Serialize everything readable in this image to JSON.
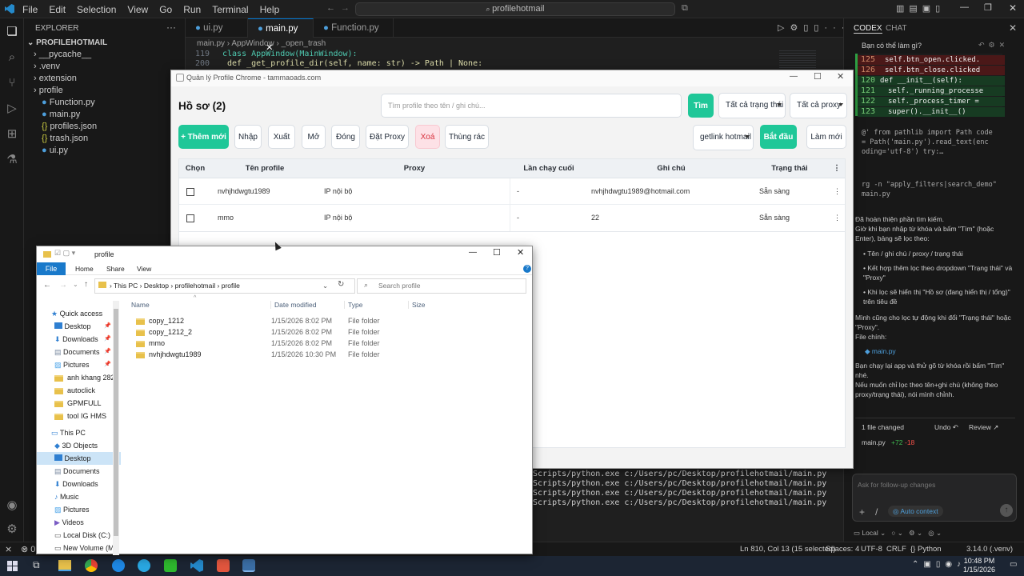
{
  "vscode": {
    "menu": [
      "File",
      "Edit",
      "Selection",
      "View",
      "Go",
      "Run",
      "Terminal",
      "Help"
    ],
    "search": "profilehotmail",
    "explorer_title": "EXPLORER",
    "project": "PROFILEHOTMAIL",
    "files": [
      "__pycache__",
      ".venv",
      "extension",
      "profile",
      "Function.py",
      "main.py",
      "profiles.json",
      "trash.json",
      "ui.py"
    ],
    "tabs": [
      "ui.py",
      "main.py",
      "Function.py"
    ],
    "breadcrumb": [
      "main.py",
      "AppWindow",
      "_open_trash"
    ],
    "code": [
      {
        "n": "119",
        "t": "class AppWindow(MainWindow):"
      },
      {
        "n": "200",
        "t": "    def _get_profile_dir(self, name: str) -> Path | None:"
      }
    ],
    "terminal": [
      "Scripts/python.exe c:/Users/pc/Desktop/profilehotmail/main.py",
      "Scripts/python.exe c:/Users/pc/Desktop/profilehotmail/main.py",
      "Scripts/python.exe c:/Users/pc/Desktop/profilehotmail/main.py",
      "Scripts/python.exe c:/Users/pc/Desktop/profilehotmail/main.py"
    ],
    "status": {
      "position": "Ln 810, Col 13 (15 selected)",
      "spaces": "Spaces: 4",
      "encoding": "UTF-8",
      "eol": "CRLF",
      "lang": "Python",
      "version": "3.14.0 (.venv)",
      "errors": "0"
    }
  },
  "codex": {
    "tabs": [
      "CODEX",
      "CHAT"
    ],
    "question": "Bạn có thể làm gì?",
    "diff": [
      {
        "n": "125",
        "t": "self.btn_open.clicked."
      },
      {
        "n": "126",
        "t": "self.btn_close.clicked"
      },
      {
        "n": "120",
        "t": "def __init__(self):"
      },
      {
        "n": "121",
        "t": "self._running_processe"
      },
      {
        "n": "122",
        "t": "self._process_timer ="
      },
      {
        "n": "123",
        "t": "super().__init__()"
      }
    ],
    "cmd1": "@' from pathlib import Path code = Path('main.py').read_text(enc oding='utf-8') try:…",
    "cmd2": "rg -n \"apply_filters|search_demo\" main.py",
    "msg1": "Đã hoàn thiện phần tìm kiếm.",
    "msg2": "Giờ khi bạn nhập từ khóa và bấm \"Tìm\" (hoặc Enter), bảng sẽ lọc theo:",
    "bullets": [
      "Tên / ghi chú / proxy / trạng thái",
      "Kết hợp thêm lọc theo dropdown \"Trạng thái\" và \"Proxy\"",
      "Khi lọc sẽ hiển thị \"Hồ sơ (đang hiển thị / tổng)\" trên tiêu đề"
    ],
    "msg3": "Mình cũng cho lọc tự động khi đổi \"Trạng thái\" hoặc \"Proxy\".",
    "msg4": "File chính:",
    "file_chip": "main.py",
    "msg5": "Bạn chạy lại app và thử gõ từ khóa rồi bấm \"Tìm\" nhé.",
    "msg6": "Nếu muốn chỉ lọc theo tên+ghi chú (không theo proxy/trạng thái), nói mình chỉnh.",
    "changed": "1 file changed",
    "undo": "Undo",
    "review": "Review",
    "changed_file": "main.py",
    "plus": "+72",
    "minus": "-18",
    "input_placeholder": "Ask for follow-up changes",
    "auto_context": "Auto context",
    "local": "Local"
  },
  "app": {
    "title": "Quản lý Profile Chrome - tammaoads.com",
    "heading": "Hồ sơ (2)",
    "search_placeholder": "Tìm profile theo tên / ghi chú...",
    "search_btn": "Tìm",
    "status_filter": "Tất cả trạng thái",
    "proxy_filter": "Tất cả proxy",
    "buttons": {
      "add": "+ Thêm mới",
      "import": "Nhập",
      "export": "Xuất",
      "open": "Mở",
      "close": "Đóng",
      "proxy": "Đặt Proxy",
      "delete": "Xoá",
      "trash": "Thùng rác",
      "start": "Bắt đầu",
      "refresh": "Làm mới"
    },
    "mode": "getlink hotmail",
    "columns": [
      "Chọn",
      "Tên profile",
      "Proxy",
      "Lần chạy cuối",
      "Ghi chú",
      "Trạng thái"
    ],
    "rows": [
      {
        "name": "nvhjhdwgtu1989",
        "proxy": "IP nội bộ",
        "last": "-",
        "note": "nvhjhdwgtu1989@hotmail.com",
        "status": "Sẵn sàng"
      },
      {
        "name": "mmo",
        "proxy": "IP nội bộ",
        "last": "-",
        "note": "22",
        "status": "Sẵn sàng"
      }
    ]
  },
  "fileexplorer": {
    "title": "profile",
    "ribbon": [
      "File",
      "Home",
      "Share",
      "View"
    ],
    "path": [
      "This PC",
      "Desktop",
      "profilehotmail",
      "profile"
    ],
    "search_placeholder": "Search profile",
    "nav": [
      "Quick access",
      "Desktop",
      "Downloads",
      "Documents",
      "Pictures",
      "anh khang 282",
      "autoclick",
      "GPMFULL",
      "tool IG HMS",
      "This PC",
      "3D Objects",
      "Desktop",
      "Documents",
      "Downloads",
      "Music",
      "Pictures",
      "Videos",
      "Local Disk (C:)",
      "New Volume (M"
    ],
    "columns": [
      "Name",
      "Date modified",
      "Type",
      "Size"
    ],
    "items": [
      {
        "name": "copy_1212",
        "date": "1/15/2026 8:02 PM",
        "type": "File folder"
      },
      {
        "name": "copy_1212_2",
        "date": "1/15/2026 8:02 PM",
        "type": "File folder"
      },
      {
        "name": "mmo",
        "date": "1/15/2026 8:02 PM",
        "type": "File folder"
      },
      {
        "name": "nvhjhdwgtu1989",
        "date": "1/15/2026 10:30 PM",
        "type": "File folder"
      }
    ]
  },
  "taskbar": {
    "time": "10:48 PM",
    "date": "1/15/2026"
  }
}
